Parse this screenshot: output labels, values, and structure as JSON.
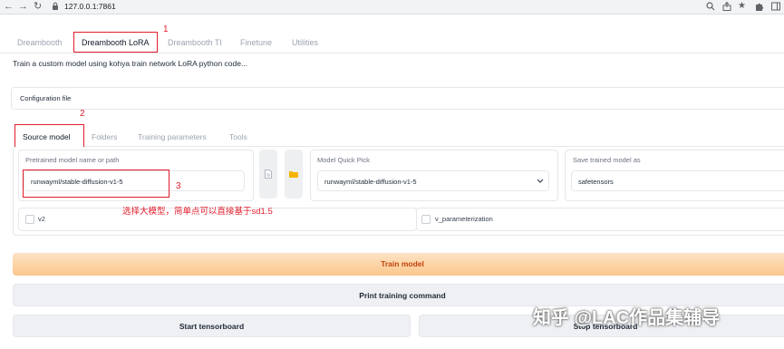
{
  "browser": {
    "url": "127.0.0.1:7861",
    "nav": {
      "back": "←",
      "forward": "→",
      "reload": "↻"
    },
    "right_icons": [
      "zoom-icon",
      "share-icon",
      "star-icon",
      "extensions-icon",
      "sidebar-icon"
    ]
  },
  "tabs": [
    "Dreambooth",
    "Dreambooth LoRA",
    "Dreambooth TI",
    "Finetune",
    "Utilities"
  ],
  "active_tab": "Dreambooth LoRA",
  "description": "Train a custom model using kohya train network LoRA python code...",
  "config": {
    "label": "Configuration file"
  },
  "subtabs": [
    "Source model",
    "Folders",
    "Training parameters",
    "Tools"
  ],
  "active_subtab": "Source model",
  "source_model": {
    "pretrained_label": "Pretrained model name or path",
    "pretrained_value": "runwayml/stable-diffusion-v1-5",
    "quick_pick_label": "Model Quick Pick",
    "quick_pick_value": "runwayml/stable-diffusion-v1-5",
    "save_as_label": "Save trained model as",
    "save_as_value": "safetensors",
    "v2_label": "v2",
    "v2_checked": false,
    "v_param_label": "v_parameterization",
    "v_param_checked": false
  },
  "buttons": {
    "train": "Train model",
    "print": "Print training command",
    "start_tb": "Start tensorboard",
    "stop_tb": "Stop tensorboard"
  },
  "annotations": {
    "n1": "1",
    "n2": "2",
    "n3": "3",
    "note": "选择大模型，简单点可以直接基于sd1.5",
    "color": "#e11d2b"
  },
  "watermark": "知乎 @LAC作品集辅导"
}
